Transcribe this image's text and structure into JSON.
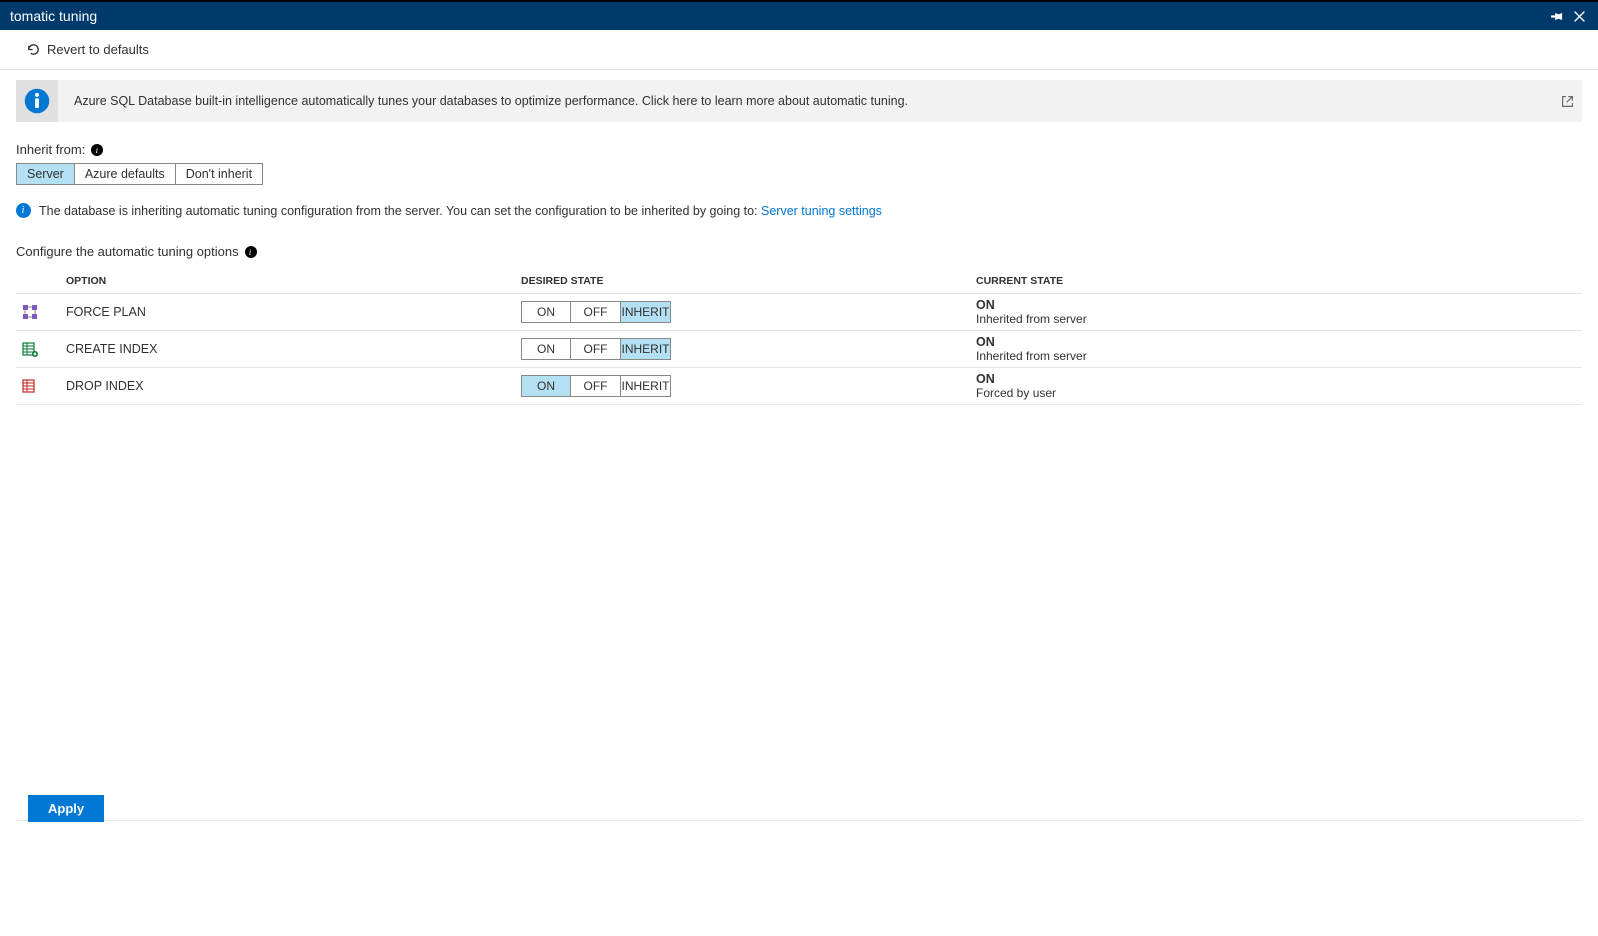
{
  "header": {
    "title": "tomatic tuning"
  },
  "toolbar": {
    "revert_label": "Revert to defaults"
  },
  "banner": {
    "text": "Azure SQL Database built-in intelligence automatically tunes your databases to optimize performance. Click here to learn more about automatic tuning."
  },
  "inherit": {
    "label": "Inherit from:",
    "options": [
      {
        "label": "Server",
        "selected": true
      },
      {
        "label": "Azure defaults",
        "selected": false
      },
      {
        "label": "Don't inherit",
        "selected": false
      }
    ]
  },
  "status": {
    "text": "The database is inheriting automatic tuning configuration from the server. You can set the configuration to be inherited by going to:",
    "link_text": "Server tuning settings"
  },
  "configure_label": "Configure the automatic tuning options",
  "columns": {
    "option": "OPTION",
    "desired": "DESIRED STATE",
    "current": "CURRENT STATE"
  },
  "state_labels": {
    "on": "ON",
    "off": "OFF",
    "inherit": "INHERIT"
  },
  "rows": [
    {
      "icon": "force-plan",
      "name": "FORCE PLAN",
      "selected": "inherit",
      "current_state": "ON",
      "current_detail": "Inherited from server"
    },
    {
      "icon": "create-index",
      "name": "CREATE INDEX",
      "selected": "inherit",
      "current_state": "ON",
      "current_detail": "Inherited from server"
    },
    {
      "icon": "drop-index",
      "name": "DROP INDEX",
      "selected": "on",
      "current_state": "ON",
      "current_detail": "Forced by user"
    }
  ],
  "footer": {
    "apply_label": "Apply"
  }
}
